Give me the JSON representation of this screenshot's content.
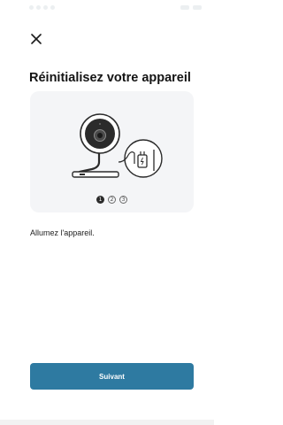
{
  "header": {
    "close_icon": "close-icon"
  },
  "page": {
    "title": "Réinitialisez votre appareil"
  },
  "illustration": {
    "steps": [
      "1",
      "2",
      "3"
    ],
    "active_step": 1,
    "icons": [
      "camera-icon",
      "power-plug-icon"
    ]
  },
  "instruction": {
    "text": "Allumez l'appareil."
  },
  "footer": {
    "next_label": "Suivant"
  },
  "colors": {
    "accent": "#2e7aa1",
    "title_text": "#141414",
    "body_text": "#222222",
    "card_background": "#f4f5f7"
  }
}
